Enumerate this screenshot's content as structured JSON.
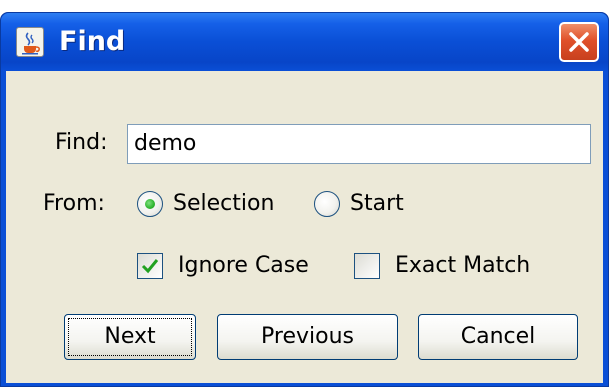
{
  "window": {
    "title": "Find",
    "app_icon": "java-cup-icon",
    "close_icon": "close-icon"
  },
  "find": {
    "label": "Find:",
    "value": "demo"
  },
  "from": {
    "label": "From:",
    "options": [
      {
        "label": "Selection",
        "selected": true
      },
      {
        "label": "Start",
        "selected": false
      }
    ]
  },
  "options": {
    "ignore_case": {
      "label": "Ignore Case",
      "checked": true
    },
    "exact_match": {
      "label": "Exact Match",
      "checked": false
    }
  },
  "buttons": {
    "next": "Next",
    "previous": "Previous",
    "cancel": "Cancel"
  },
  "colors": {
    "titlebar": "#0a4fd6",
    "dialog_bg": "#ece9d8",
    "radio_dot": "#2fb52f",
    "check_mark": "#21a121",
    "close_button": "#e0502a"
  }
}
